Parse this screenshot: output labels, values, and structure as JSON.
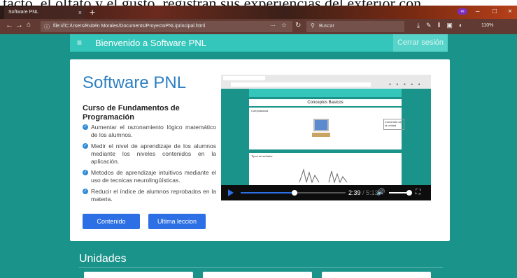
{
  "document": {
    "top_text": "tacto, el olfato y el gusto, registran sus experiencias del exterior con"
  },
  "browser": {
    "tab_title": "Software PNL",
    "tab_close": "×",
    "new_tab": "+",
    "url": "file:///C:/Users/Rubén Morales/Documents/ProyectoPNL/principal.html",
    "url_more": "···",
    "search_placeholder": "Buscar",
    "zoom": "110%",
    "window_controls": [
      "–",
      "□",
      "×"
    ]
  },
  "app": {
    "title": "Bienvenido a Software PNL",
    "logout_label": "Cerrar sesión",
    "menu_icon": "hamburger-icon"
  },
  "card": {
    "title": "Software PNL",
    "course": "Curso de Fundamentos de Programación",
    "objectives": [
      "Aumentar el razonamiento lógico matemático de los alumnos.",
      "Medir el nivel de aprendizaje de los alumnos mediante los niveles contenidos en la aplicación.",
      "Metodos de aprendizaje intuitivos mediante el uso de tecnicas neurolingüísticas.",
      "Reducir el índice de alumnos reprobados en la materia."
    ],
    "buttons": {
      "contenido": "Contenido",
      "ultima": "Ultima leccion"
    }
  },
  "video": {
    "current_time": "2:39",
    "duration": "/ 5:13",
    "progress": 0.51,
    "volume": 1.0,
    "screen": {
      "header": "Conceptos Basicos",
      "label_computadora": "Computadora",
      "side_box": "Contenido de la unidad",
      "label_tipos": "Tipos de señales:"
    }
  },
  "section": {
    "units_title": "Unidades"
  },
  "colors": {
    "page_bg": "#1a938a",
    "appbar": "#35c6bb",
    "primary_button": "#2d6fe4",
    "title_blue": "#2e7fc2"
  }
}
